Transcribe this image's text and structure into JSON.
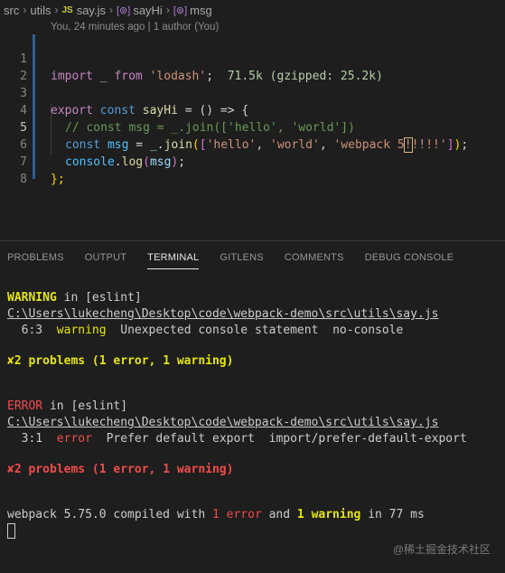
{
  "breadcrumb": {
    "items": [
      "src",
      "utils",
      "say.js",
      "sayHi",
      "msg"
    ],
    "js_badge": "JS",
    "symbol_icon": "[⊚]"
  },
  "editor": {
    "blame": "You, 24 minutes ago | 1 author (You)",
    "import_size_hint": "71.5k (gzipped: 25.2k)",
    "lines": {
      "l1": {
        "num": "1",
        "kw": "import",
        "name": "_",
        "from": "from",
        "mod": "'lodash'",
        "semi": ";"
      },
      "l2": {
        "num": "2"
      },
      "l3": {
        "num": "3",
        "kw1": "export",
        "kw2": "const",
        "name": "sayHi",
        "rest": " = () => {"
      },
      "l4": {
        "num": "4",
        "comment": "// const msg = _.join(['hello', 'world'])"
      },
      "l5": {
        "num": "5",
        "kw": "const",
        "name": "msg",
        "eq": " = ",
        "obj": "_",
        "dot": ".",
        "fn": "join",
        "s1": "'hello'",
        "s2": "'world'",
        "s3a": "'webpack 5",
        "s3b": "!",
        "s3c": "!!!!'",
        "end": ";"
      },
      "l6": {
        "num": "6",
        "obj": "console",
        "fn": "log",
        "arg": "msg",
        "end": ";"
      },
      "l7": {
        "num": "7",
        "text": "};"
      },
      "l8": {
        "num": "8"
      }
    }
  },
  "panel": {
    "tabs": [
      "PROBLEMS",
      "OUTPUT",
      "TERMINAL",
      "GITLENS",
      "COMMENTS",
      "DEBUG CONSOLE"
    ],
    "active_tab": "TERMINAL"
  },
  "terminal": {
    "warning_label": "WARNING",
    "in_eslint": " in [eslint]",
    "path": "C:\\Users\\lukecheng\\Desktop\\code\\webpack-demo\\src\\utils\\say.js",
    "warn_pos": "6:3",
    "warn_word": "warning",
    "warn_msg": "Unexpected console statement",
    "warn_rule": "no-console",
    "problems_1": "2 problems (1 error, 1 warning)",
    "error_label": "ERROR",
    "err_pos": "3:1",
    "err_word": "error",
    "err_msg": "Prefer default export",
    "err_rule": "import/prefer-default-export",
    "problems_2": "2 problems (1 error, 1 warning)",
    "compiled_prefix": "webpack 5.75.0 compiled with ",
    "err_count": "1 error",
    "and": " and ",
    "warn_count": "1 warning",
    "compiled_suffix": " in 77 ms",
    "cross": "✘"
  },
  "watermark": "@稀土掘金技术社区"
}
